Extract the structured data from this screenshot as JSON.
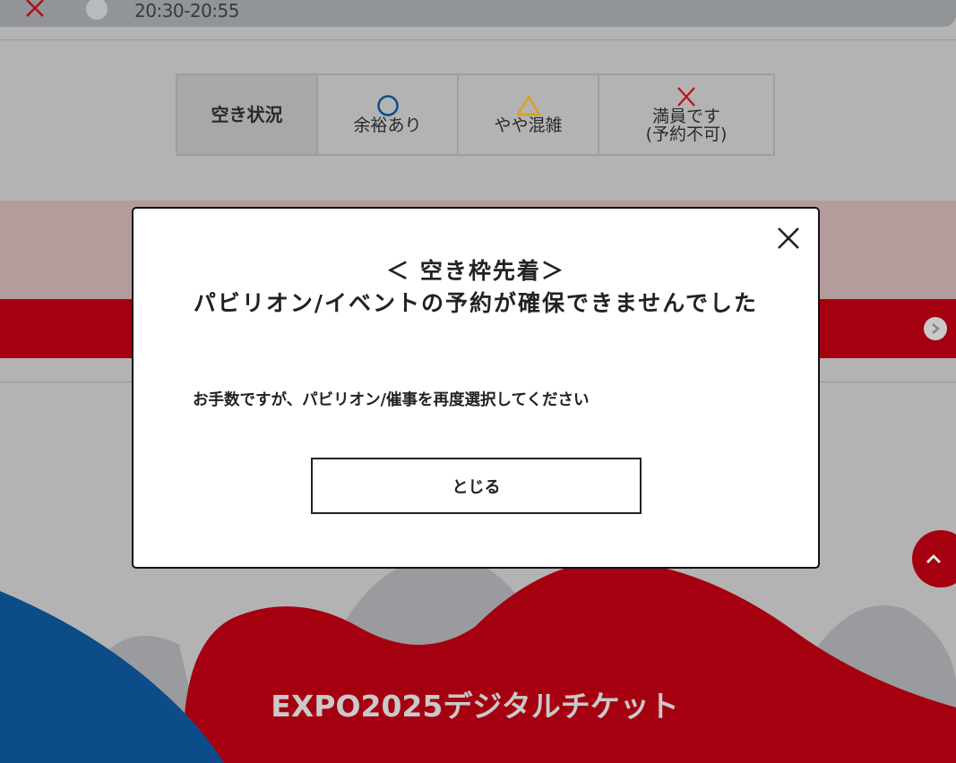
{
  "time_slot": {
    "time": "20:30-20:55"
  },
  "legend": {
    "header": "空き状況",
    "items": [
      {
        "symbol": "circle-icon",
        "label": "余裕あり"
      },
      {
        "symbol": "triangle-icon",
        "label": "やや混雑"
      },
      {
        "symbol": "cross-icon",
        "label_line1": "満員です",
        "label_line2": "(予約不可)"
      }
    ]
  },
  "modal": {
    "title_line1": "＜ 空き枠先着＞",
    "title_line2": "パビリオン/イベントの予約が確保できませんでした",
    "message": "お手数ですが、パビリオン/催事を再度選択してください",
    "close_button": "とじる"
  },
  "footer": {
    "title": "EXPO2025デジタルチケット"
  },
  "colors": {
    "accent_red": "#a50010",
    "blue": "#0b4c89",
    "gold": "#d9a21a"
  }
}
